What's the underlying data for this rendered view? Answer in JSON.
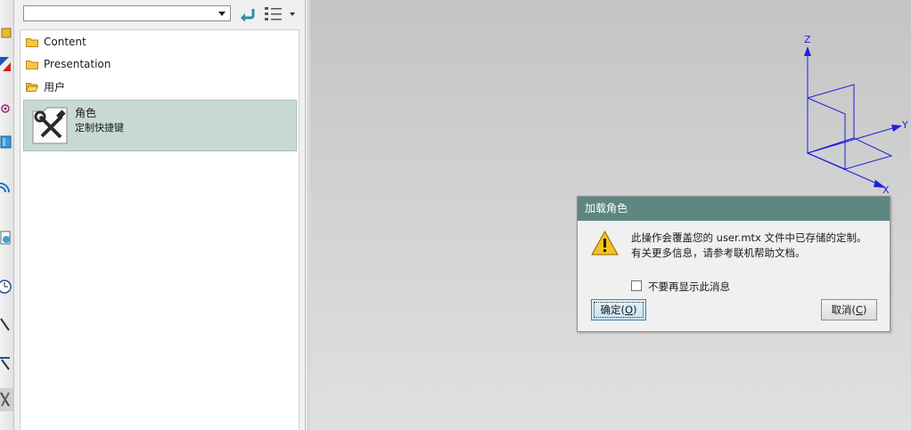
{
  "resource_panel": {
    "combo_value": "",
    "tree_items": [
      {
        "label": "Content",
        "icon": "folder-closed-icon"
      },
      {
        "label": "Presentation",
        "icon": "folder-closed-icon"
      },
      {
        "label": "用户",
        "icon": "folder-open-icon"
      }
    ],
    "role_item": {
      "title": "角色",
      "description": "定制快捷键",
      "icon": "tools-icon"
    }
  },
  "axes": {
    "z": "Z",
    "y": "Y",
    "x": "X",
    "color": "#1f1fe0"
  },
  "dialog": {
    "title": "加载角色",
    "message_line1": "此操作会覆盖您的 user.mtx 文件中已存储的定制。",
    "message_line2": "有关更多信息，请参考联机帮助文档。",
    "checkbox_label": "不要再显示此消息",
    "checkbox_checked": false,
    "ok_label": "确定(",
    "ok_key": "O",
    "ok_tail": ")",
    "cancel_label": "取消(",
    "cancel_key": "C",
    "cancel_tail": ")",
    "title_bar_color": "#5d8780"
  }
}
